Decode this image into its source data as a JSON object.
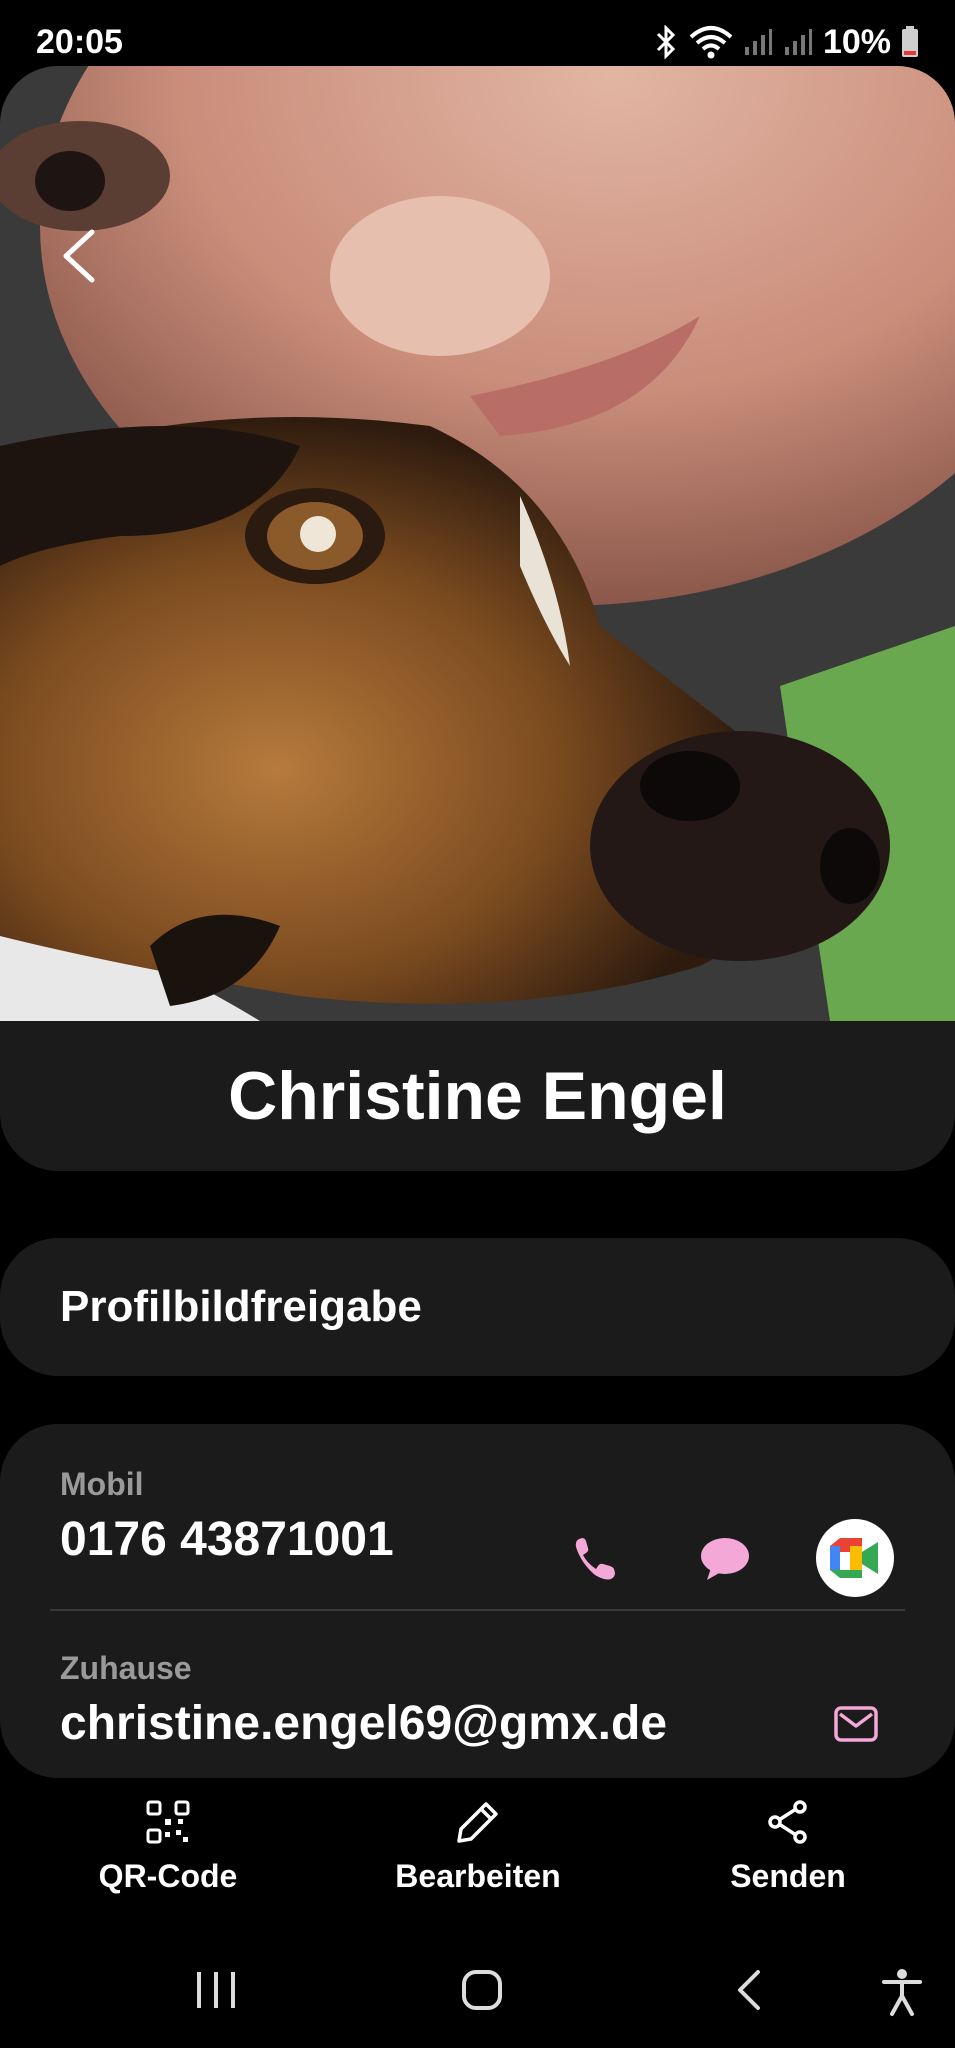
{
  "status": {
    "time": "20:05",
    "battery": "10%"
  },
  "contact": {
    "name": "Christine Engel",
    "profile_share_label": "Profilbildfreigabe",
    "phone": {
      "label": "Mobil",
      "value": "0176 43871001"
    },
    "email": {
      "label": "Zuhause",
      "value": "christine.engel69@gmx.de"
    }
  },
  "actions": {
    "qr_label": "QR-Code",
    "edit_label": "Bearbeiten",
    "share_label": "Senden"
  },
  "icons": {
    "back": "chevron-left-icon",
    "call": "phone-icon",
    "message": "chat-bubble-icon",
    "video": "google-meet-icon",
    "email": "envelope-icon",
    "qr": "qr-code-icon",
    "edit": "pencil-icon",
    "share": "share-icon"
  },
  "colors": {
    "accent": "#f3a8d8",
    "card": "#1b1b1b",
    "secondary_text": "#9a9a9a"
  }
}
